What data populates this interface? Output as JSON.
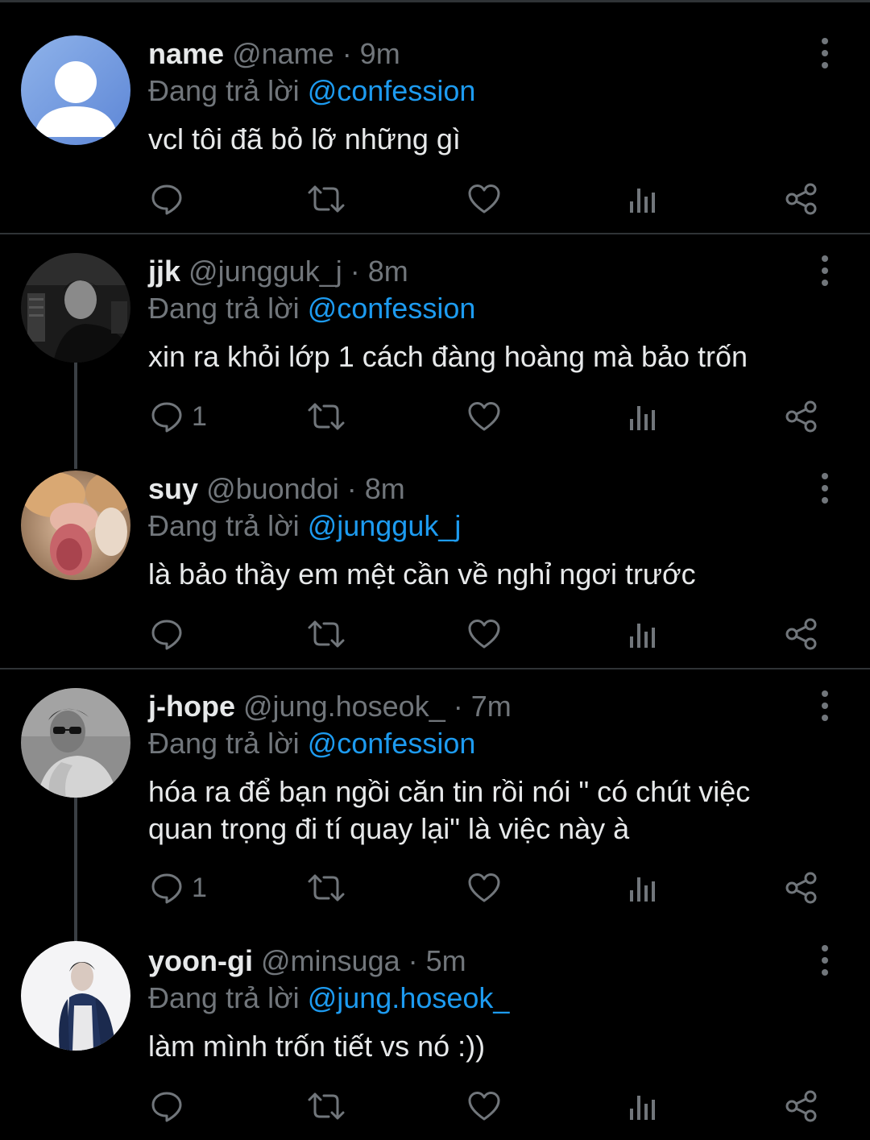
{
  "tweets": [
    {
      "name": "name",
      "handle": "@name",
      "time": "· 9m",
      "replying_prefix": "Đang trả lời",
      "replying_to": "@confession",
      "text": "vcl tôi đã bỏ lỡ những gì",
      "reply_count": ""
    },
    {
      "name": "jjk",
      "handle": "@jungguk_j",
      "time": "· 8m",
      "replying_prefix": "Đang trả lời",
      "replying_to": "@confession",
      "text": "xin ra khỏi lớp 1 cách đàng hoàng mà bảo trốn",
      "reply_count": "1"
    },
    {
      "name": "suy",
      "handle": "@buondoi",
      "time": "· 8m",
      "replying_prefix": "Đang trả lời",
      "replying_to": "@jungguk_j",
      "text": "là bảo thầy em mệt cần về nghỉ ngơi trước",
      "reply_count": ""
    },
    {
      "name": "j-hope",
      "handle": "@jung.hoseok_",
      "time": "· 7m",
      "replying_prefix": "Đang trả lời",
      "replying_to": "@confession",
      "text": "hóa ra để bạn ngồi căn tin rồi nói \" có chút việc quan trọng đi tí quay lại\" là việc này à",
      "reply_count": "1"
    },
    {
      "name": "yoon-gi",
      "handle": "@minsuga",
      "time": "· 5m",
      "replying_prefix": "Đang trả lời",
      "replying_to": "@jung.hoseok_",
      "text": "làm mình trốn tiết vs nó :))",
      "reply_count": ""
    }
  ],
  "icons": {
    "reply": "reply-icon",
    "retweet": "retweet-icon",
    "like": "heart-icon",
    "views": "views-icon",
    "share": "share-icon",
    "more": "more-icon"
  },
  "colors": {
    "background": "#000000",
    "text": "#e7e9ea",
    "muted": "#71767b",
    "accent": "#1d9bf0",
    "border": "#2f3336"
  }
}
